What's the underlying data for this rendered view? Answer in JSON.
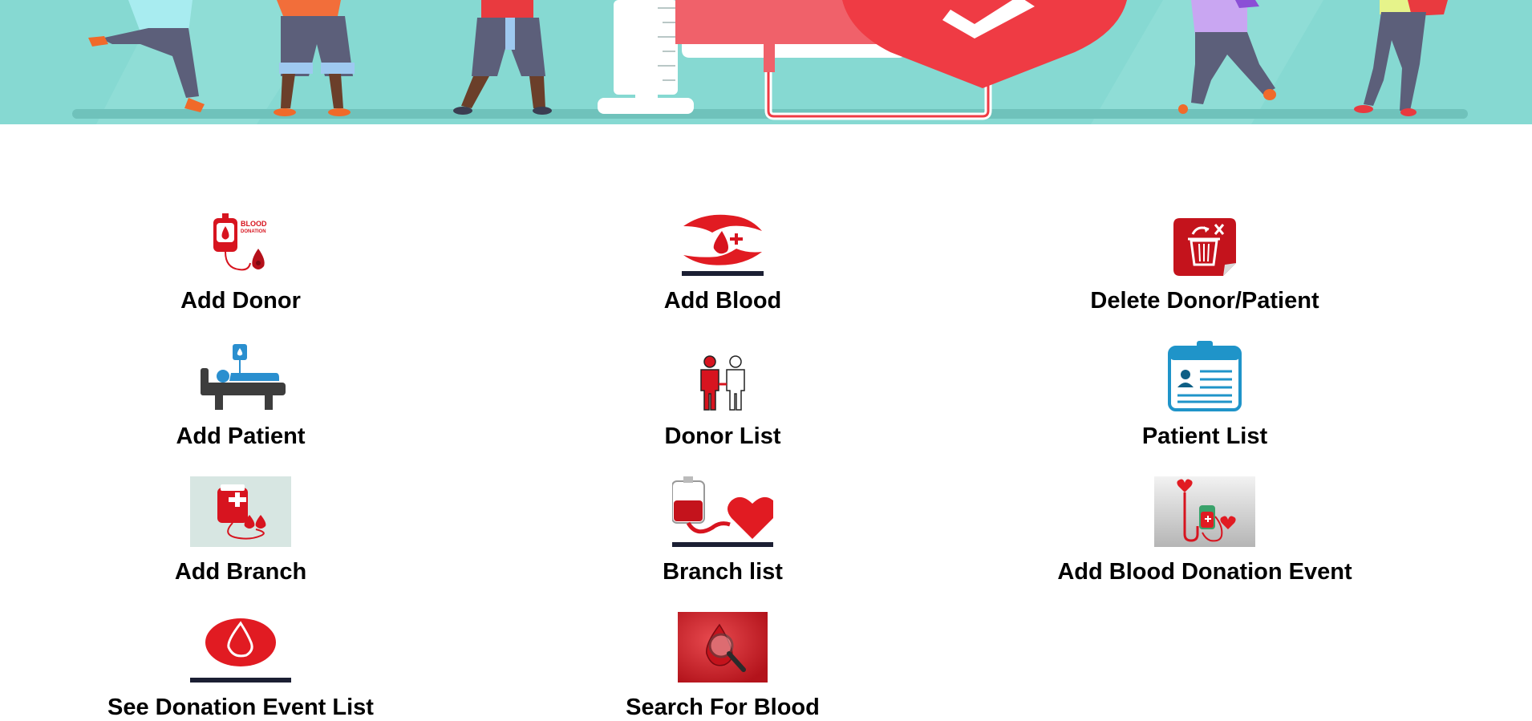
{
  "banner": {
    "icon": "blood-donation-banner-illustration",
    "colors": {
      "background": "#86d9d2",
      "heart": "#ef3b44",
      "bag": "#f0616a"
    }
  },
  "menu": [
    {
      "label": "Add Donor",
      "icon": "blood-bag-donation-icon"
    },
    {
      "label": "Add Blood",
      "icon": "hands-blood-drop-icon"
    },
    {
      "label": "Delete Donor/Patient",
      "icon": "trash-delete-icon"
    },
    {
      "label": "Add Patient",
      "icon": "patient-bed-transfusion-icon"
    },
    {
      "label": "Donor List",
      "icon": "donor-people-icon"
    },
    {
      "label": "Patient List",
      "icon": "clipboard-list-icon"
    },
    {
      "label": "Add Branch",
      "icon": "blood-bag-branch-icon"
    },
    {
      "label": "Branch list",
      "icon": "blood-bag-heart-icon"
    },
    {
      "label": "Add Blood Donation Event",
      "icon": "donation-event-icon"
    },
    {
      "label": "See Donation Event List",
      "icon": "blood-drop-button-icon"
    },
    {
      "label": "Search For Blood",
      "icon": "magnifier-blood-drop-icon"
    }
  ]
}
